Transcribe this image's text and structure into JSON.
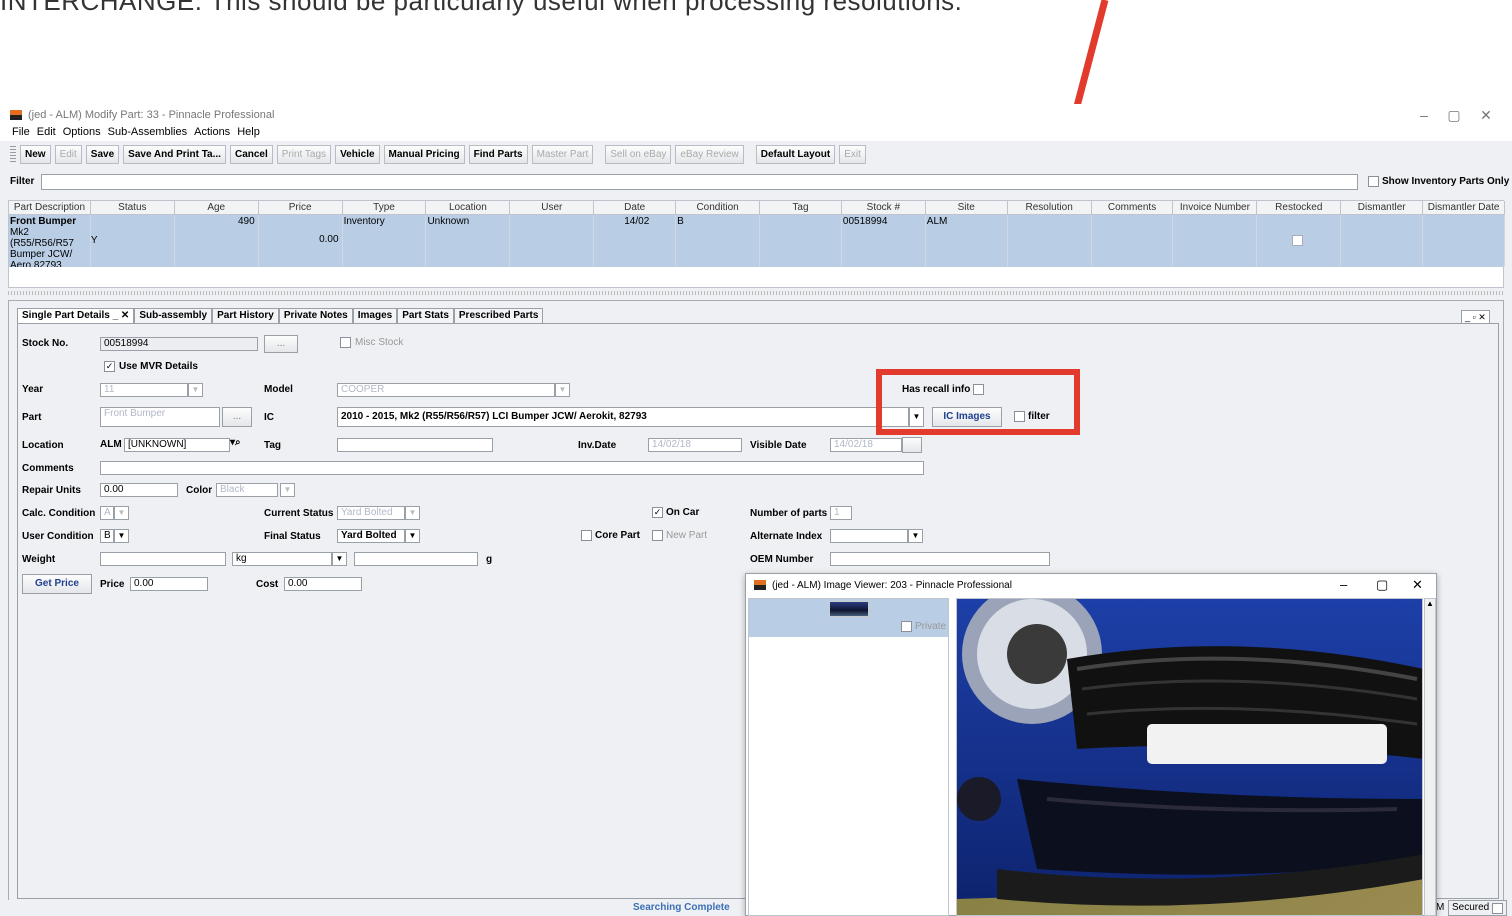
{
  "caption": "INTERCHANGE. This should be particularly useful when processing resolutions.",
  "window": {
    "title": "(jed - ALM) Modify Part: 33 - Pinnacle Professional",
    "minimize": "–",
    "maximize": "▢",
    "close": "✕"
  },
  "menu": [
    "File",
    "Edit",
    "Options",
    "Sub-Assemblies",
    "Actions",
    "Help"
  ],
  "toolbar": {
    "buttons": [
      {
        "label": "New",
        "enabled": true
      },
      {
        "label": "Edit",
        "enabled": false
      },
      {
        "label": "Save",
        "enabled": true
      },
      {
        "label": "Save And Print Ta...",
        "enabled": true
      },
      {
        "label": "Cancel",
        "enabled": true
      },
      {
        "label": "Print Tags",
        "enabled": false
      },
      {
        "label": "Vehicle",
        "enabled": true
      },
      {
        "label": "Manual Pricing",
        "enabled": true
      },
      {
        "label": "Find Parts",
        "enabled": true
      },
      {
        "label": "Master Part",
        "enabled": false
      },
      {
        "label": "Sell on eBay",
        "enabled": false
      },
      {
        "label": "eBay Review",
        "enabled": false
      },
      {
        "label": "Default Layout",
        "enabled": true
      },
      {
        "label": "Exit",
        "enabled": false
      }
    ]
  },
  "filter": {
    "label": "Filter",
    "value": "",
    "show_inventory_label": "Show Inventory Parts Only",
    "show_inventory_checked": false
  },
  "grid": {
    "columns": [
      "Part Description",
      "Status",
      "Age",
      "Price",
      "Type",
      "Location",
      "User",
      "Date",
      "Condition",
      "Tag",
      "Stock #",
      "Site",
      "Resolution",
      "Comments",
      "Invoice Number",
      "Restocked",
      "Dismantler",
      "Dismantler Date"
    ],
    "row": {
      "desc_title": "Front Bumper",
      "desc_lines": "Mk2 (R55/R56/R57 Bumper JCW/ Aero 82793",
      "status": "Y",
      "age": "490",
      "price": "0.00",
      "type": "Inventory",
      "location": "Unknown",
      "user": "",
      "date": "14/02",
      "condition": "B",
      "tag": "",
      "stock": "00518994",
      "site": "ALM",
      "resolution": "",
      "comments": "",
      "invoice": "",
      "restocked": false,
      "dismantler": "",
      "dismantler_date": ""
    }
  },
  "tabs": [
    "Single Part Details",
    "Sub-assembly",
    "Part History",
    "Private Notes",
    "Images",
    "Part Stats",
    "Prescribed Parts"
  ],
  "tab_controls": "_ ✕",
  "panel_controls": "_ ▫ ✕",
  "form": {
    "stock_no_label": "Stock No.",
    "stock_no": "00518994",
    "ellipsis": "...",
    "misc_stock_label": "Misc Stock",
    "use_mvr_label": "Use MVR Details",
    "use_mvr_checked": true,
    "year_label": "Year",
    "year": "11",
    "model_label": "Model",
    "model": "COOPER",
    "has_recall_label": "Has recall info",
    "part_label": "Part",
    "part": "Front Bumper",
    "ic_label": "IC",
    "ic": "2010 - 2015, Mk2 (R55/R56/R57) LCI Bumper JCW/ Aerokit, 82793",
    "ic_images_label": "IC Images",
    "filter_label": "filter",
    "location_label": "Location",
    "location_site": "ALM",
    "location": "[UNKNOWN]",
    "tag_label": "Tag",
    "tag": "",
    "inv_date_label": "Inv.Date",
    "inv_date": "14/02/18",
    "visible_date_label": "Visible Date",
    "visible_date": "14/02/18",
    "comments_label": "Comments",
    "comments": "",
    "repair_units_label": "Repair Units",
    "repair_units": "0.00",
    "color_label": "Color",
    "color": "Black",
    "calc_condition_label": "Calc. Condition",
    "calc_condition": "A",
    "current_status_label": "Current Status",
    "current_status": "Yard Bolted",
    "on_car_label": "On Car",
    "on_car_checked": true,
    "number_of_parts_label": "Number of parts",
    "number_of_parts": "1",
    "user_condition_label": "User Condition",
    "user_condition": "B",
    "final_status_label": "Final Status",
    "final_status": "Yard Bolted",
    "core_part_label": "Core Part",
    "new_part_label": "New Part",
    "alternate_index_label": "Alternate Index",
    "alternate_index": "",
    "weight_label": "Weight",
    "weight": "",
    "weight_unit": "kg",
    "grams": "",
    "grams_unit": "g",
    "oem_number_label": "OEM Number",
    "oem_number": "",
    "get_price_label": "Get Price",
    "price_label": "Price",
    "price": "0.00",
    "cost_label": "Cost",
    "cost": "0.00"
  },
  "status": {
    "text": "Searching Complete",
    "secured_label": "Secured",
    "left_fragment": "M"
  },
  "image_viewer": {
    "title": "(jed - ALM) Image Viewer: 203 - Pinnacle Professional",
    "private_label": "Private",
    "minimize": "–",
    "maximize": "▢",
    "close": "✕"
  },
  "colors": {
    "accent_red": "#e23a2c",
    "selection": "#b9cde5"
  }
}
